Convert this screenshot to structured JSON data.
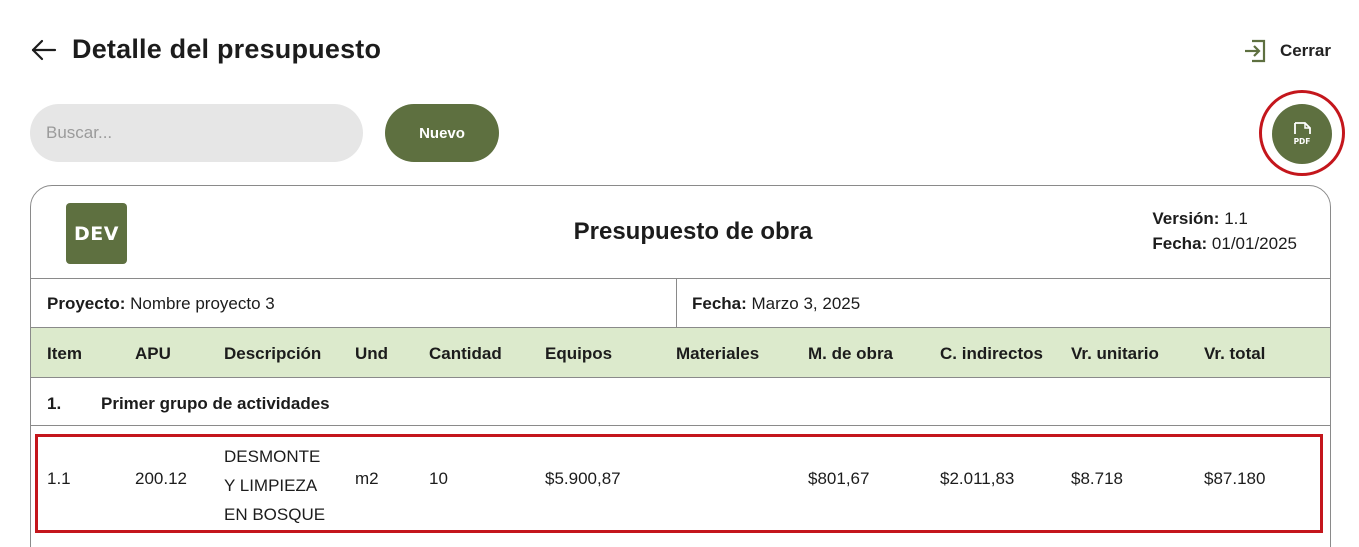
{
  "header": {
    "title": "Detalle del presupuesto",
    "close_label": "Cerrar"
  },
  "toolbar": {
    "search_placeholder": "Buscar...",
    "new_label": "Nuevo",
    "pdf_label": "PDF"
  },
  "document": {
    "logo_text": "DEV",
    "title": "Presupuesto de obra",
    "version_label": "Versión:",
    "version_value": " 1.1",
    "date_label": "Fecha:",
    "date_value": " 01/01/2025",
    "project_label": "Proyecto:",
    "project_value": " Nombre proyecto 3",
    "project_date_label": "Fecha:",
    "project_date_value": " Marzo 3, 2025"
  },
  "table": {
    "columns": [
      "Item",
      "APU",
      "Descripción",
      "Und",
      "Cantidad",
      "Equipos",
      "Materiales",
      "M. de obra",
      "C. indirectos",
      "Vr. unitario",
      "Vr. total"
    ],
    "group": {
      "number": "1.",
      "name": "Primer grupo de actividades"
    },
    "rows": [
      {
        "item": "1.1",
        "apu": "200.12",
        "description_lines": [
          "DESMONTE",
          "Y LIMPIEZA",
          "EN BOSQUE"
        ],
        "unit": "m2",
        "quantity": "10",
        "equipment": "$5.900,87",
        "materials": "",
        "labor": "$801,67",
        "indirect": "$2.011,83",
        "unit_price": "$8.718",
        "total": "$87.180"
      }
    ]
  },
  "colors": {
    "accent_green": "#5e7040",
    "header_green": "#dceacc",
    "highlight_red": "#c4161c"
  }
}
